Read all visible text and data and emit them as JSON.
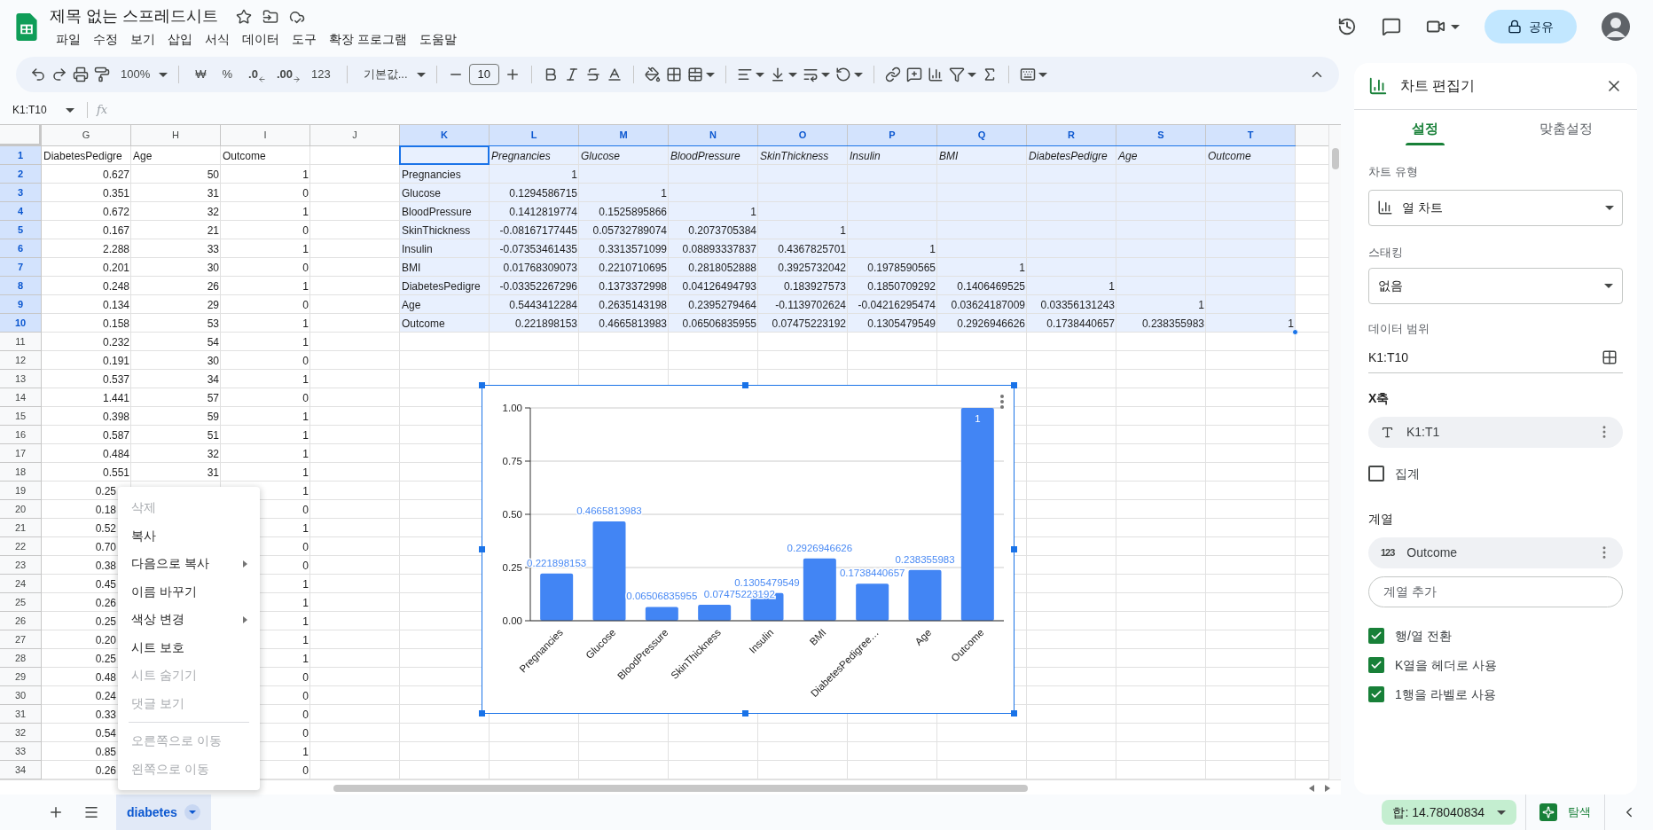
{
  "document": {
    "title": "제목 없는 스프레드시트",
    "menu": [
      "파일",
      "수정",
      "보기",
      "삽입",
      "서식",
      "데이터",
      "도구",
      "확장 프로그램",
      "도움말"
    ],
    "share": "공유"
  },
  "toolbar": {
    "zoom": "100%",
    "currency": "₩",
    "percent": "%",
    "decrease_decimal": ".0",
    "increase_decimal": ".00",
    "number_format": "123",
    "font": "기본값...",
    "font_size": "10"
  },
  "formula_bar": {
    "name_box": "K1:T10",
    "fx": "fx"
  },
  "sheet": {
    "columns": [
      {
        "label": "G",
        "selected": false
      },
      {
        "label": "H",
        "selected": false
      },
      {
        "label": "I",
        "selected": false
      },
      {
        "label": "J",
        "selected": false
      },
      {
        "label": "K",
        "selected": true
      },
      {
        "label": "L",
        "selected": true
      },
      {
        "label": "M",
        "selected": true
      },
      {
        "label": "N",
        "selected": true
      },
      {
        "label": "O",
        "selected": true
      },
      {
        "label": "P",
        "selected": true
      },
      {
        "label": "Q",
        "selected": true
      },
      {
        "label": "R",
        "selected": true
      },
      {
        "label": "S",
        "selected": true
      },
      {
        "label": "T",
        "selected": true
      }
    ],
    "rows": [
      {
        "label": "1",
        "selected": true,
        "g": "DiabetesPedigre",
        "h": "Age",
        "i": "Outcome"
      },
      {
        "label": "2",
        "selected": true,
        "g": "0.627",
        "h": "50",
        "i": "1"
      },
      {
        "label": "3",
        "selected": true,
        "g": "0.351",
        "h": "31",
        "i": "0"
      },
      {
        "label": "4",
        "selected": true,
        "g": "0.672",
        "h": "32",
        "i": "1"
      },
      {
        "label": "5",
        "selected": true,
        "g": "0.167",
        "h": "21",
        "i": "0"
      },
      {
        "label": "6",
        "selected": true,
        "g": "2.288",
        "h": "33",
        "i": "1"
      },
      {
        "label": "7",
        "selected": true,
        "g": "0.201",
        "h": "30",
        "i": "0"
      },
      {
        "label": "8",
        "selected": true,
        "g": "0.248",
        "h": "26",
        "i": "1"
      },
      {
        "label": "9",
        "selected": true,
        "g": "0.134",
        "h": "29",
        "i": "0"
      },
      {
        "label": "10",
        "selected": true,
        "g": "0.158",
        "h": "53",
        "i": "1"
      },
      {
        "label": "11",
        "selected": false,
        "g": "0.232",
        "h": "54",
        "i": "1"
      },
      {
        "label": "12",
        "selected": false,
        "g": "0.191",
        "h": "30",
        "i": "0"
      },
      {
        "label": "13",
        "selected": false,
        "g": "0.537",
        "h": "34",
        "i": "1"
      },
      {
        "label": "14",
        "selected": false,
        "g": "1.441",
        "h": "57",
        "i": "0"
      },
      {
        "label": "15",
        "selected": false,
        "g": "0.398",
        "h": "59",
        "i": "1"
      },
      {
        "label": "16",
        "selected": false,
        "g": "0.587",
        "h": "51",
        "i": "1"
      },
      {
        "label": "17",
        "selected": false,
        "g": "0.484",
        "h": "32",
        "i": "1"
      },
      {
        "label": "18",
        "selected": false,
        "g": "0.551",
        "h": "31",
        "i": "1"
      },
      {
        "label": "19",
        "selected": false,
        "g": "0.25",
        "i": "1"
      },
      {
        "label": "20",
        "selected": false,
        "g": "0.18",
        "i": "0"
      },
      {
        "label": "21",
        "selected": false,
        "g": "0.52",
        "i": "1"
      },
      {
        "label": "22",
        "selected": false,
        "g": "0.70",
        "i": "0"
      },
      {
        "label": "23",
        "selected": false,
        "g": "0.38",
        "i": "0"
      },
      {
        "label": "24",
        "selected": false,
        "g": "0.45",
        "i": "1"
      },
      {
        "label": "25",
        "selected": false,
        "g": "0.26",
        "i": "1"
      },
      {
        "label": "26",
        "selected": false,
        "g": "0.25",
        "i": "1"
      },
      {
        "label": "27",
        "selected": false,
        "g": "0.20",
        "i": "1"
      },
      {
        "label": "28",
        "selected": false,
        "g": "0.25",
        "i": "1"
      },
      {
        "label": "29",
        "selected": false,
        "g": "0.48",
        "i": "0"
      },
      {
        "label": "30",
        "selected": false,
        "g": "0.24",
        "i": "0"
      },
      {
        "label": "31",
        "selected": false,
        "g": "0.33",
        "i": "0"
      },
      {
        "label": "32",
        "selected": false,
        "g": "0.54",
        "i": "0"
      },
      {
        "label": "33",
        "selected": false,
        "g": "0.85",
        "i": "1"
      },
      {
        "label": "34",
        "selected": false,
        "g": "0.26",
        "i": "0"
      }
    ]
  },
  "correlation": {
    "header": [
      "Pregnancies",
      "Glucose",
      "BloodPressure",
      "SkinThickness",
      "Insulin",
      "BMI",
      "DiabetesPedigre",
      "Age",
      "Outcome"
    ],
    "rows": [
      {
        "label": "Pregnancies",
        "values": [
          "1"
        ]
      },
      {
        "label": "Glucose",
        "values": [
          "0.1294586715",
          "1"
        ]
      },
      {
        "label": "BloodPressure",
        "values": [
          "0.1412819774",
          "0.1525895866",
          "1"
        ]
      },
      {
        "label": "SkinThickness",
        "values": [
          "-0.08167177445",
          "0.05732789074",
          "0.2073705384",
          "1"
        ]
      },
      {
        "label": "Insulin",
        "values": [
          "-0.07353461435",
          "0.3313571099",
          "0.08893337837",
          "0.4367825701",
          "1"
        ]
      },
      {
        "label": "BMI",
        "values": [
          "0.01768309073",
          "0.2210710695",
          "0.2818052888",
          "0.3925732042",
          "0.1978590565",
          "1"
        ]
      },
      {
        "label": "DiabetesPedigre",
        "values": [
          "-0.03352267296",
          "0.1373372998",
          "0.04126494793",
          "0.183927573",
          "0.1850709292",
          "0.1406469525",
          "1"
        ]
      },
      {
        "label": "Age",
        "values": [
          "0.5443412284",
          "0.2635143198",
          "0.2395279464",
          "-0.1139702624",
          "-0.04216295474",
          "0.03624187009",
          "0.03356131243",
          "1"
        ]
      },
      {
        "label": "Outcome",
        "values": [
          "0.221898153",
          "0.4665813983",
          "0.06506835955",
          "0.07475223192",
          "0.1305479549",
          "0.2926946626",
          "0.1738440657",
          "0.238355983",
          "1"
        ]
      }
    ]
  },
  "chart": {
    "chart_data": {
      "type": "bar",
      "categories": [
        "Pregnancies",
        "Glucose",
        "BloodPressure",
        "SkinThickness",
        "Insulin",
        "BMI",
        "DiabetesPedigree…",
        "Age",
        "Outcome"
      ],
      "values": [
        0.221898153,
        0.4665813983,
        0.06506835955,
        0.07475223192,
        0.1305479549,
        0.2926946626,
        0.1738440657,
        0.238355983,
        1
      ],
      "ylim": [
        0,
        1
      ],
      "yticks": [
        {
          "value": 0,
          "label": "0.00"
        },
        {
          "value": 0.25,
          "label": "0.25"
        },
        {
          "value": 0.5,
          "label": "0.50"
        },
        {
          "value": 0.75,
          "label": "0.75"
        },
        {
          "value": 1,
          "label": "1.00"
        }
      ],
      "grid": true,
      "data_labels": true
    }
  },
  "context_menu": [
    {
      "kind": "item",
      "label": "삭제",
      "disabled": true,
      "submenu": false
    },
    {
      "kind": "item",
      "label": "복사",
      "disabled": false,
      "submenu": false
    },
    {
      "kind": "item",
      "label": "다음으로 복사",
      "disabled": false,
      "submenu": true
    },
    {
      "kind": "item",
      "label": "이름 바꾸기",
      "disabled": false,
      "submenu": false
    },
    {
      "kind": "item",
      "label": "색상 변경",
      "disabled": false,
      "submenu": true
    },
    {
      "kind": "item",
      "label": "시트 보호",
      "disabled": false,
      "submenu": false
    },
    {
      "kind": "item",
      "label": "시트 숨기기",
      "disabled": true,
      "submenu": false
    },
    {
      "kind": "item",
      "label": "댓글 보기",
      "disabled": true,
      "submenu": false
    },
    {
      "kind": "divider"
    },
    {
      "kind": "item",
      "label": "오른쪽으로 이동",
      "disabled": true,
      "submenu": false
    },
    {
      "kind": "item",
      "label": "왼쪽으로 이동",
      "disabled": true,
      "submenu": false
    }
  ],
  "chart_editor": {
    "title": "차트 편집기",
    "tabs": [
      {
        "label": "설정",
        "selected": true
      },
      {
        "label": "맞춤설정",
        "selected": false
      }
    ],
    "chart_type": {
      "label": "차트 유형",
      "value": "열 차트"
    },
    "stacking": {
      "label": "스태킹",
      "value": "없음"
    },
    "data_range": {
      "label": "데이터 범위",
      "value": "K1:T10"
    },
    "x_axis": {
      "label": "X축",
      "range": "K1:T1"
    },
    "aggregate": {
      "label": "집계",
      "checked": false
    },
    "series": {
      "label": "계열",
      "items": [
        {
          "type": "123",
          "name": "Outcome"
        }
      ],
      "add": "계열 추가"
    },
    "options": [
      {
        "label": "행/열 전환",
        "checked": true
      },
      {
        "label": "K열을 헤더로 사용",
        "checked": true
      },
      {
        "label": "1행을 라벨로 사용",
        "checked": true
      }
    ]
  },
  "bottom_bar": {
    "sheet_tabs": [
      {
        "label": "diabetes",
        "selected": true
      }
    ],
    "sum": "합: 14.78040834",
    "explore": "탐색"
  }
}
